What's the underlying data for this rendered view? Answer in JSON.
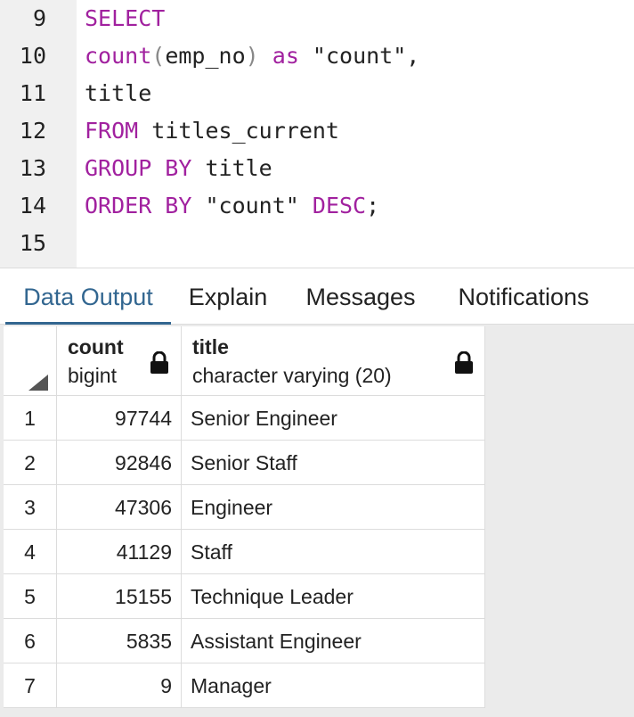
{
  "editor": {
    "lines": [
      {
        "no": "9",
        "segments": [
          {
            "t": "SELECT",
            "c": "kw"
          }
        ]
      },
      {
        "no": "10",
        "segments": [
          {
            "t": "count",
            "c": "fn"
          },
          {
            "t": "(",
            "c": "paren"
          },
          {
            "t": "emp_no",
            "c": "plain"
          },
          {
            "t": ")",
            "c": "paren"
          },
          {
            "t": " ",
            "c": "plain"
          },
          {
            "t": "as",
            "c": "kw"
          },
          {
            "t": " \"count\",",
            "c": "plain"
          }
        ]
      },
      {
        "no": "11",
        "segments": [
          {
            "t": "title",
            "c": "plain"
          }
        ]
      },
      {
        "no": "12",
        "segments": [
          {
            "t": "FROM",
            "c": "kw"
          },
          {
            "t": " titles_current",
            "c": "plain"
          }
        ]
      },
      {
        "no": "13",
        "segments": [
          {
            "t": "GROUP BY",
            "c": "kw"
          },
          {
            "t": " title",
            "c": "plain"
          }
        ]
      },
      {
        "no": "14",
        "segments": [
          {
            "t": "ORDER BY",
            "c": "kw"
          },
          {
            "t": " \"count\" ",
            "c": "plain"
          },
          {
            "t": "DESC",
            "c": "kw"
          },
          {
            "t": ";",
            "c": "plain"
          }
        ]
      },
      {
        "no": "15",
        "segments": []
      }
    ]
  },
  "tabs": [
    {
      "label": "Data Output",
      "active": true
    },
    {
      "label": "Explain",
      "active": false
    },
    {
      "label": "Messages",
      "active": false
    },
    {
      "label": "Notifications",
      "active": false
    }
  ],
  "grid": {
    "columns": [
      {
        "name": "count",
        "type": "bigint",
        "icon": "lock-icon"
      },
      {
        "name": "title",
        "type": "character varying (20)",
        "icon": "lock-icon"
      }
    ],
    "rows": [
      {
        "n": "1",
        "count": "97744",
        "title": "Senior Engineer"
      },
      {
        "n": "2",
        "count": "92846",
        "title": "Senior Staff"
      },
      {
        "n": "3",
        "count": "47306",
        "title": "Engineer"
      },
      {
        "n": "4",
        "count": "41129",
        "title": "Staff"
      },
      {
        "n": "5",
        "count": "15155",
        "title": "Technique Leader"
      },
      {
        "n": "6",
        "count": "5835",
        "title": "Assistant Engineer"
      },
      {
        "n": "7",
        "count": "9",
        "title": "Manager"
      }
    ]
  },
  "colors": {
    "keyword": "#a1219f",
    "active_tab": "#326690"
  }
}
